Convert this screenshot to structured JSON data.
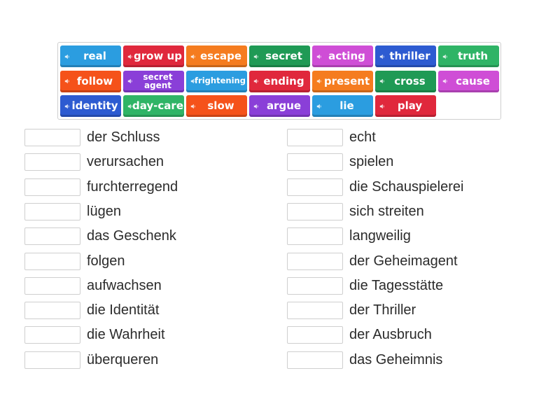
{
  "tiles": [
    {
      "label": "real",
      "color": "#2b9de0"
    },
    {
      "label": "grow up",
      "color": "#e0283c"
    },
    {
      "label": "escape",
      "color": "#f57c1f"
    },
    {
      "label": "secret",
      "color": "#1f9a55"
    },
    {
      "label": "acting",
      "color": "#cf4ed6"
    },
    {
      "label": "thriller",
      "color": "#2d5bd1"
    },
    {
      "label": "truth",
      "color": "#2fb466"
    },
    {
      "label": "follow",
      "color": "#f5521a"
    },
    {
      "label": "secret agent",
      "color": "#8a3fd8"
    },
    {
      "label": "frightening",
      "color": "#2b9de0"
    },
    {
      "label": "ending",
      "color": "#e0283c"
    },
    {
      "label": "present",
      "color": "#f57c1f"
    },
    {
      "label": "cross",
      "color": "#1f9a55"
    },
    {
      "label": "cause",
      "color": "#cf4ed6"
    },
    {
      "label": "identity",
      "color": "#2d5bd1"
    },
    {
      "label": "day-care",
      "color": "#2fb466"
    },
    {
      "label": "slow",
      "color": "#f5521a"
    },
    {
      "label": "argue",
      "color": "#8a3fd8"
    },
    {
      "label": "lie",
      "color": "#2b9de0"
    },
    {
      "label": "play",
      "color": "#e0283c"
    }
  ],
  "left_targets": [
    "der Schluss",
    "verursachen",
    "furchterregend",
    "lügen",
    "das Geschenk",
    "folgen",
    "aufwachsen",
    "die Identität",
    "die Wahrheit",
    "überqueren"
  ],
  "right_targets": [
    "echt",
    "spielen",
    "die Schauspielerei",
    "sich streiten",
    "langweilig",
    "der Geheimagent",
    "die Tagesstätte",
    "der Thriller",
    "der Ausbruch",
    "das Geheimnis"
  ],
  "icons": {
    "tile_icon": "speaker-icon"
  }
}
